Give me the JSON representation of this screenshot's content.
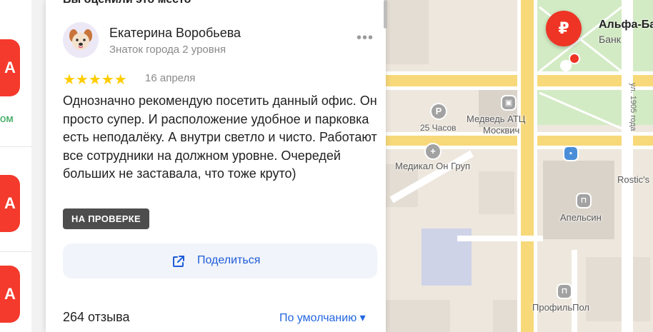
{
  "left_panel": {
    "badge_letter": "A",
    "fragment_text": "ом"
  },
  "review_panel": {
    "previous_title": "Вы оценили это место",
    "author_name": "Екатерина Воробьева",
    "author_level": "Знаток города 2 уровня",
    "more_label": "•••",
    "rating_stars": 5,
    "stars_text": "★★★★★",
    "date": "16 апреля",
    "review_text": "Однозначно рекомендую посетить данный офис. Он просто супер. И расположение удобное и парковка есть неподалёку. А внутри светло и чисто. Работают все сотрудники на должном уровне. Очередей больших не заставала, что тоже круто)",
    "status_badge": "НА ПРОВЕРКЕ",
    "share_label": "Поделиться",
    "reviews_count": "264 отзыва",
    "sort_label": "По умолчанию ▾"
  },
  "map": {
    "bank_name": "Альфа-Ба",
    "bank_category": "Банк",
    "bank_symbol": "₽",
    "labels": {
      "medved": "Медведь АТЦ",
      "moskvich": "Москвич",
      "chasov": "25 Часов",
      "medical": "Медикал Он Груп",
      "apelsin": "Апельсин",
      "rostics": "Rostic's",
      "profilpol": "ПрофильПол",
      "street_1905": "ул. 1905 года",
      "street_left": "ул."
    }
  },
  "colors": {
    "brand_red": "#ee3424",
    "link_blue": "#2367e0",
    "star_yellow": "#ffcc00",
    "road_yellow": "#f7d97a"
  }
}
